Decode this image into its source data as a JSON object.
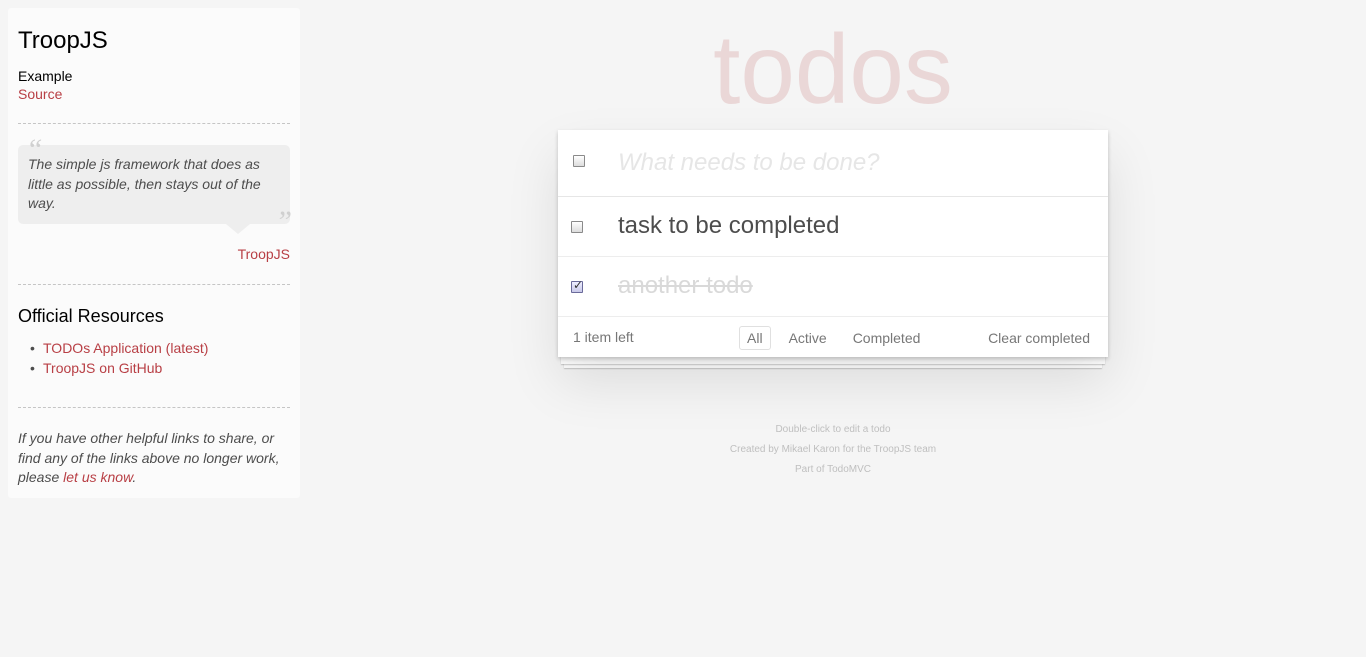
{
  "sidebar": {
    "title": "TroopJS",
    "example_label": "Example",
    "source_link": "Source",
    "quote": "The simple js framework that does as little as possible, then stays out of the way.",
    "quote_author": "TroopJS",
    "resources_title": "Official Resources",
    "resources": [
      "TODOs Application (latest)",
      "TroopJS on GitHub"
    ],
    "footer_text": "If you have other helpful links to share, or find any of the links above no longer work, please",
    "footer_link": "let us know",
    "footer_end": "."
  },
  "app": {
    "heading": "todos",
    "new_todo_placeholder": "What needs to be done?",
    "items": [
      {
        "label": "task to be completed",
        "completed": false
      },
      {
        "label": "another todo",
        "completed": true
      }
    ],
    "footer": {
      "count": "1 item left",
      "filters": [
        "All",
        "Active",
        "Completed"
      ],
      "selected_filter": "All",
      "clear": "Clear completed"
    }
  },
  "info": {
    "line1": "Double-click to edit a todo",
    "line2": "Created by Mikael Karon for the TroopJS team",
    "line3": "Part of TodoMVC"
  }
}
